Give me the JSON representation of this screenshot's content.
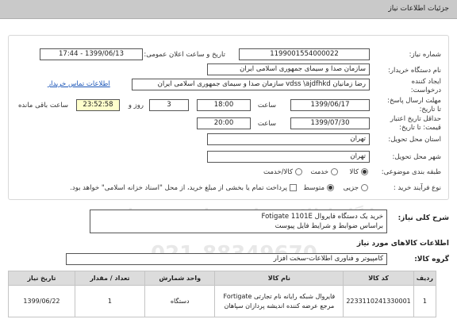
{
  "header": {
    "title": "جزئیات اطلاعات نیاز"
  },
  "form": {
    "need_number_label": "شماره نیاز:",
    "need_number": "1199001554000022",
    "announce_label": "تاریخ و ساعت اعلان عمومی:",
    "announce_value": "1399/06/13 - 17:44",
    "buyer_label": "نام دستگاه خریدار:",
    "buyer_value": "سازمان صدا و سیمای جمهوری اسلامی ایران",
    "creator_label": "ایجاد کننده درخواست:",
    "creator_value": "رضا زمانیان vdss \\ajdfhkd سازمان صدا و سیمای جمهوری اسلامی ایران",
    "contact_link": "اطلاعات تماس خریدار",
    "reply_deadline_label": "مهلت ارسال پاسخ: تا تاریخ:",
    "reply_date": "1399/06/17",
    "time_label": "ساعت",
    "reply_time": "18:00",
    "days_value": "3",
    "days_label": "روز و",
    "countdown": "23:52:58",
    "remaining_label": "ساعت باقی مانده",
    "price_validity_label": "حداقل تاریخ اعتبار قیمت: تا تاریخ:",
    "validity_date": "1399/07/30",
    "validity_time_label": "ساعت",
    "validity_time": "20:00",
    "province_label": "استان محل تحویل:",
    "province_value": "تهران",
    "city_label": "شهر محل تحویل:",
    "city_value": "تهران",
    "category_label": "طبقه بندی موضوعی:",
    "category_options": [
      "کالا",
      "خدمت",
      "کالا/خدمت"
    ],
    "process_label": "نوع فرآیند خرید :",
    "process_options": [
      "جزیی",
      "متوسط"
    ],
    "payment_note": "پرداخت تمام یا بخشی از مبلغ خرید، از محل \"اسناد خزانه اسلامی\" خواهد بود."
  },
  "description": {
    "label": "شرح کلی نیاز:",
    "line1": "خرید یک دستگاه فایروال  Fotigate 1101E",
    "line2": "براساس ضوابط و شرایط فایل پیوست"
  },
  "goods": {
    "section_title": "اطلاعات کالاهای مورد نیاز",
    "group_label": "گروه کالا:",
    "group_value": "کامپیوتر و فناوری اطلاعات-سخت افزار"
  },
  "table": {
    "headers": [
      "ردیف",
      "کد کالا",
      "نام کالا",
      "واحد شمارش",
      "تعداد / مقدار",
      "تاریخ نیاز"
    ],
    "rows": [
      [
        "1",
        "2233110241330001",
        "فایروال شبکه رایانه نام تجارتی Fortigate مرجع عرضه کننده اندیشه پردازان سپاهان",
        "دستگاه",
        "1",
        "1399/06/22"
      ]
    ]
  },
  "watermark": {
    "line1": "مرکز فراخوان استعلام",
    "line2": "ParsNamadData",
    "line3": "پایگاه اطلاع رسانی مناقصه ومزایده",
    "line4": "021-88349670"
  }
}
